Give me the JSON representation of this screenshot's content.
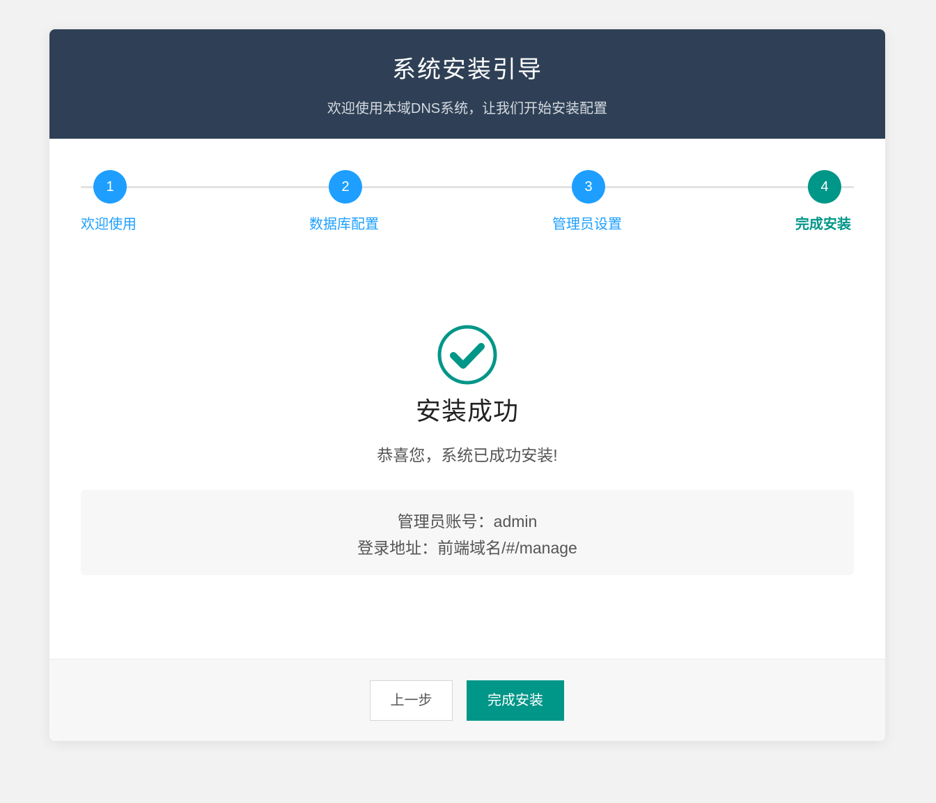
{
  "header": {
    "title": "系统安装引导",
    "subtitle": "欢迎使用本域DNS系统，让我们开始安装配置"
  },
  "steps": [
    {
      "number": "1",
      "label": "欢迎使用",
      "state": "done"
    },
    {
      "number": "2",
      "label": "数据库配置",
      "state": "done"
    },
    {
      "number": "3",
      "label": "管理员设置",
      "state": "done"
    },
    {
      "number": "4",
      "label": "完成安装",
      "state": "active"
    }
  ],
  "result": {
    "icon": "check-circle-icon",
    "title": "安装成功",
    "message": "恭喜您，系统已成功安装!"
  },
  "info": {
    "admin_account": "管理员账号：admin",
    "login_url": "登录地址：前端域名/#/manage"
  },
  "footer": {
    "prev_label": "上一步",
    "finish_label": "完成安装"
  },
  "colors": {
    "header_bg": "#2f4056",
    "step_blue": "#1e9fff",
    "accent_green": "#009688"
  }
}
